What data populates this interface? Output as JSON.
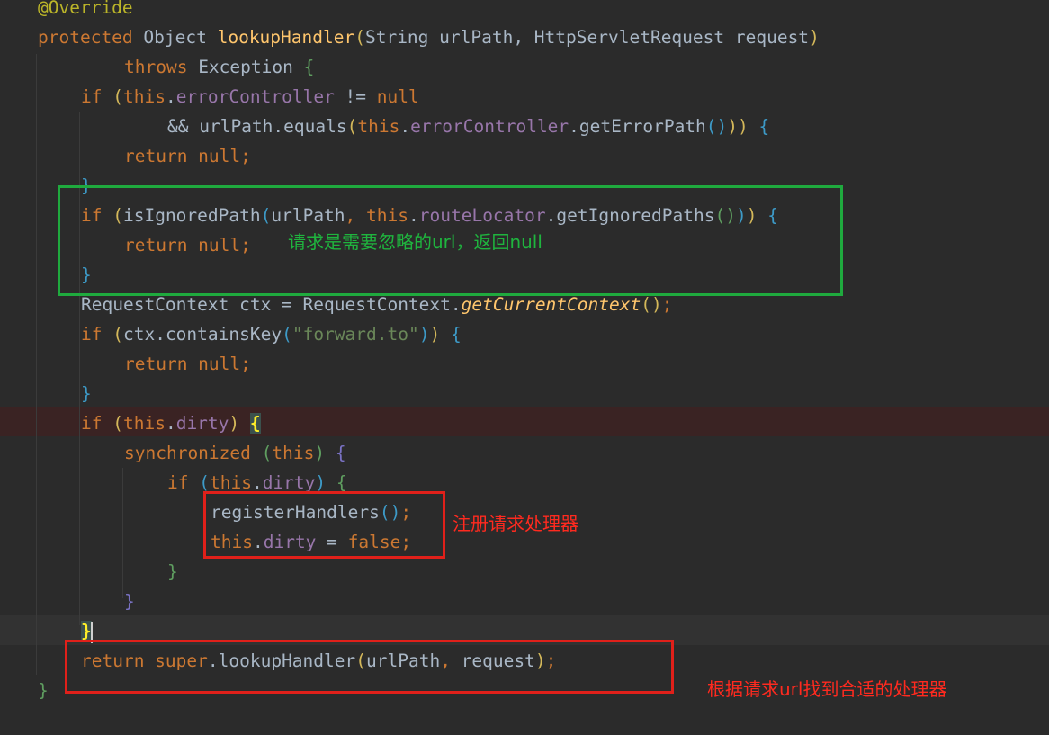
{
  "code": {
    "l1": {
      "annotation": "@Override"
    },
    "l2": {
      "kw": "protected",
      "type": " Object ",
      "name": "lookupHandler",
      "po": "(",
      "params": "String urlPath, HttpServletRequest request",
      "pc": ")"
    },
    "l3": {
      "kw": "throws",
      "exc": " Exception ",
      "brace": "{"
    },
    "l4": {
      "kw": "if",
      "sp": " ",
      "po": "(",
      "this": "this",
      "dot": ".",
      "field": "errorController",
      "op": " != ",
      "null": "null"
    },
    "l5": {
      "op": "&& urlPath.equals",
      "po": "(",
      "this": "this",
      "dot": ".",
      "field": "errorController",
      "call": ".getErrorPath",
      "inner": "()",
      "pc": ")",
      "pc2": ")",
      "brace": " {"
    },
    "l6": {
      "kw": "return null",
      "semi": ";"
    },
    "l7": {
      "brace": "}"
    },
    "l8": {
      "kw": "if",
      "sp": " ",
      "po": "(",
      "call": "isIgnoredPath",
      "po2": "(",
      "arg1": "urlPath",
      "comma": ", ",
      "this": "this",
      "dot": ".",
      "field": "routeLocator",
      "call2": ".getIgnoredPaths",
      "inner": "()",
      "pc": ")",
      "pc2": ")",
      "brace": " {"
    },
    "l9": {
      "kw": "return null",
      "semi": ";"
    },
    "l10": {
      "brace": "}"
    },
    "l11": {
      "text": "RequestContext ctx = RequestContext.",
      "call": "getCurrentContext",
      "paren": "()",
      "semi": ";"
    },
    "l12": {
      "kw": "if",
      "sp": " ",
      "po": "(",
      "text": "ctx.containsKey",
      "po2": "(",
      "str": "\"forward.to\"",
      "pc2": ")",
      "pc": ")",
      "brace": " {"
    },
    "l13": {
      "kw": "return null",
      "semi": ";"
    },
    "l14": {
      "brace": "}"
    },
    "l15": {
      "kw": "if",
      "sp": " ",
      "po": "(",
      "this": "this",
      "dot": ".",
      "field": "dirty",
      "pc": ")",
      "sp2": " ",
      "brace": "{"
    },
    "l16": {
      "kw": "synchronized",
      "sp": " ",
      "po": "(",
      "this": "this",
      "pc": ")",
      "brace": " {"
    },
    "l17": {
      "kw": "if",
      "sp": " ",
      "po": "(",
      "this": "this",
      "dot": ".",
      "field": "dirty",
      "pc": ")",
      "brace": " {"
    },
    "l18": {
      "call": "registerHandlers",
      "paren": "()",
      "semi": ";"
    },
    "l19": {
      "this": "this",
      "dot": ".",
      "field": "dirty",
      "op": " = ",
      "kw": "false",
      "semi": ";"
    },
    "l20": {
      "brace": "}"
    },
    "l21": {
      "brace": "}"
    },
    "l22": {
      "brace": "}"
    },
    "l23": {
      "kw": "return super",
      "text": ".lookupHandler",
      "po": "(",
      "arg1": "urlPath",
      "comma": ", ",
      "arg2": "request",
      "pc": ")",
      "semi": ";"
    },
    "l24": {
      "brace": "}"
    }
  },
  "notes": {
    "ignored": "请求是需要忽略的url，返回null",
    "register": "注册请求处理器",
    "lookup": "根据请求url找到合适的处理器"
  },
  "colors": {
    "background": "#2b2b2b",
    "keyword": "#cc7832",
    "method": "#ffc66d",
    "field": "#9876aa",
    "string": "#6a8759",
    "green_box": "#1faa3e",
    "red_box": "#e0201a"
  }
}
